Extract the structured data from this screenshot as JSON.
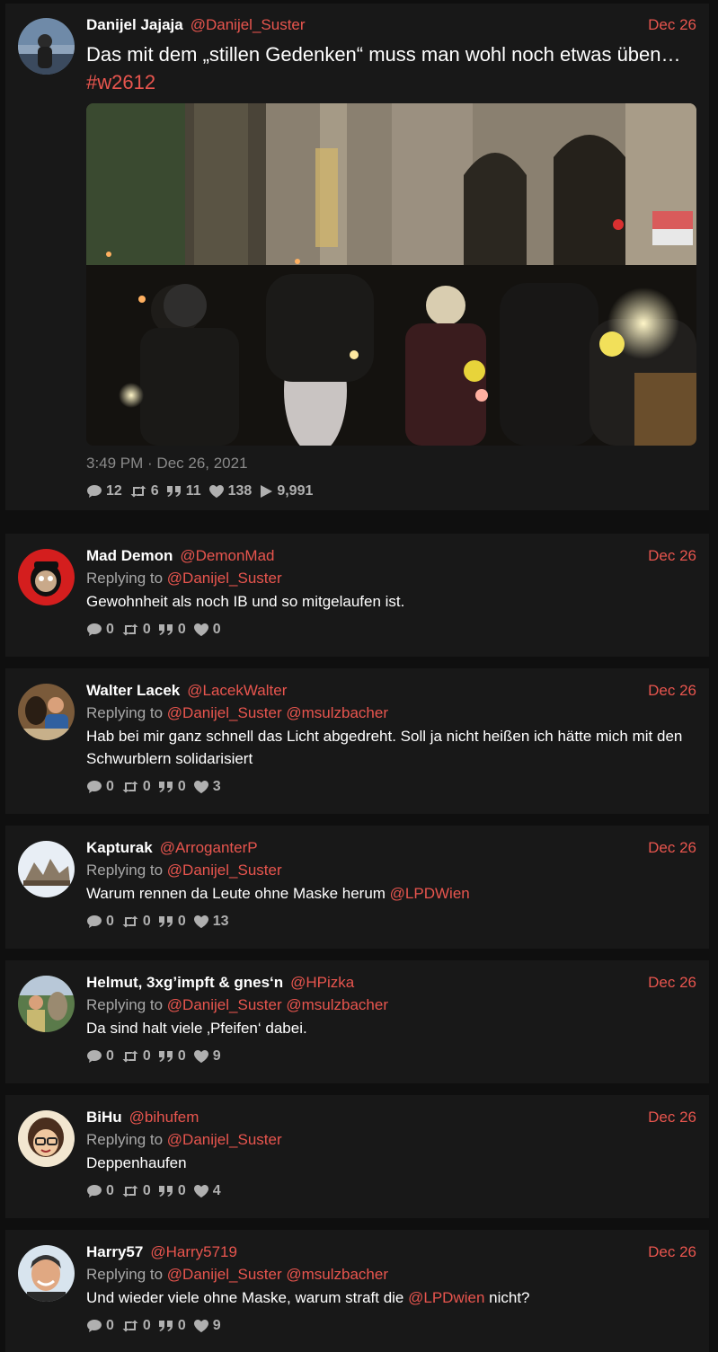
{
  "main": {
    "fullname": "Danijel Jajaja",
    "username": "@Danijel_Suster",
    "date": "Dec 26",
    "text": "Das mit dem „stillen Gedenken“ muss man wohl noch etwas üben… ",
    "hashtag": "#w2612",
    "timestamp": "3:49 PM · Dec 26, 2021",
    "stats": {
      "replies": "12",
      "retweets": "6",
      "quotes": "11",
      "likes": "138",
      "views": "9,991"
    }
  },
  "replies": [
    {
      "fullname": "Mad Demon",
      "username": "@DemonMad",
      "date": "Dec 26",
      "replying_prefix": "Replying to",
      "replying_to": "@Danijel_Suster",
      "replying_to2": "",
      "text": "Gewohnheit als noch IB und so mitgelaufen ist.",
      "mention": "",
      "text_after": "",
      "stats": {
        "replies": "0",
        "retweets": "0",
        "quotes": "0",
        "likes": "0"
      }
    },
    {
      "fullname": "Walter Lacek",
      "username": "@LacekWalter",
      "date": "Dec 26",
      "replying_prefix": "Replying to",
      "replying_to": "@Danijel_Suster",
      "replying_to2": "@msulzbacher",
      "text": "Hab bei mir ganz schnell das Licht abgedreht. Soll ja nicht heißen ich hätte mich mit den Schwurblern solidarisiert",
      "mention": "",
      "text_after": "",
      "stats": {
        "replies": "0",
        "retweets": "0",
        "quotes": "0",
        "likes": "3"
      }
    },
    {
      "fullname": "Kapturak",
      "username": "@ArroganterP",
      "date": "Dec 26",
      "replying_prefix": "Replying to",
      "replying_to": "@Danijel_Suster",
      "replying_to2": "",
      "text": "Warum rennen da Leute ohne Maske herum ",
      "mention": "@LPDWien",
      "text_after": "",
      "stats": {
        "replies": "0",
        "retweets": "0",
        "quotes": "0",
        "likes": "13"
      }
    },
    {
      "fullname": "Helmut, 3xg’impft & gnes‘n",
      "username": "@HPizka",
      "date": "Dec 26",
      "replying_prefix": "Replying to",
      "replying_to": "@Danijel_Suster",
      "replying_to2": "@msulzbacher",
      "text": "Da sind halt viele ‚Pfeifen‘ dabei.",
      "mention": "",
      "text_after": "",
      "stats": {
        "replies": "0",
        "retweets": "0",
        "quotes": "0",
        "likes": "9"
      }
    },
    {
      "fullname": "BiHu",
      "username": "@bihufem",
      "date": "Dec 26",
      "replying_prefix": "Replying to",
      "replying_to": "@Danijel_Suster",
      "replying_to2": "",
      "text": "Deppenhaufen",
      "mention": "",
      "text_after": "",
      "stats": {
        "replies": "0",
        "retweets": "0",
        "quotes": "0",
        "likes": "4"
      }
    },
    {
      "fullname": "Harry57",
      "username": "@Harry5719",
      "date": "Dec 26",
      "replying_prefix": "Replying to",
      "replying_to": "@Danijel_Suster",
      "replying_to2": "@msulzbacher",
      "text": "Und wieder viele ohne Maske, warum straft die ",
      "mention": "@LPDwien",
      "text_after": " nicht?",
      "stats": {
        "replies": "0",
        "retweets": "0",
        "quotes": "0",
        "likes": "9"
      }
    }
  ]
}
